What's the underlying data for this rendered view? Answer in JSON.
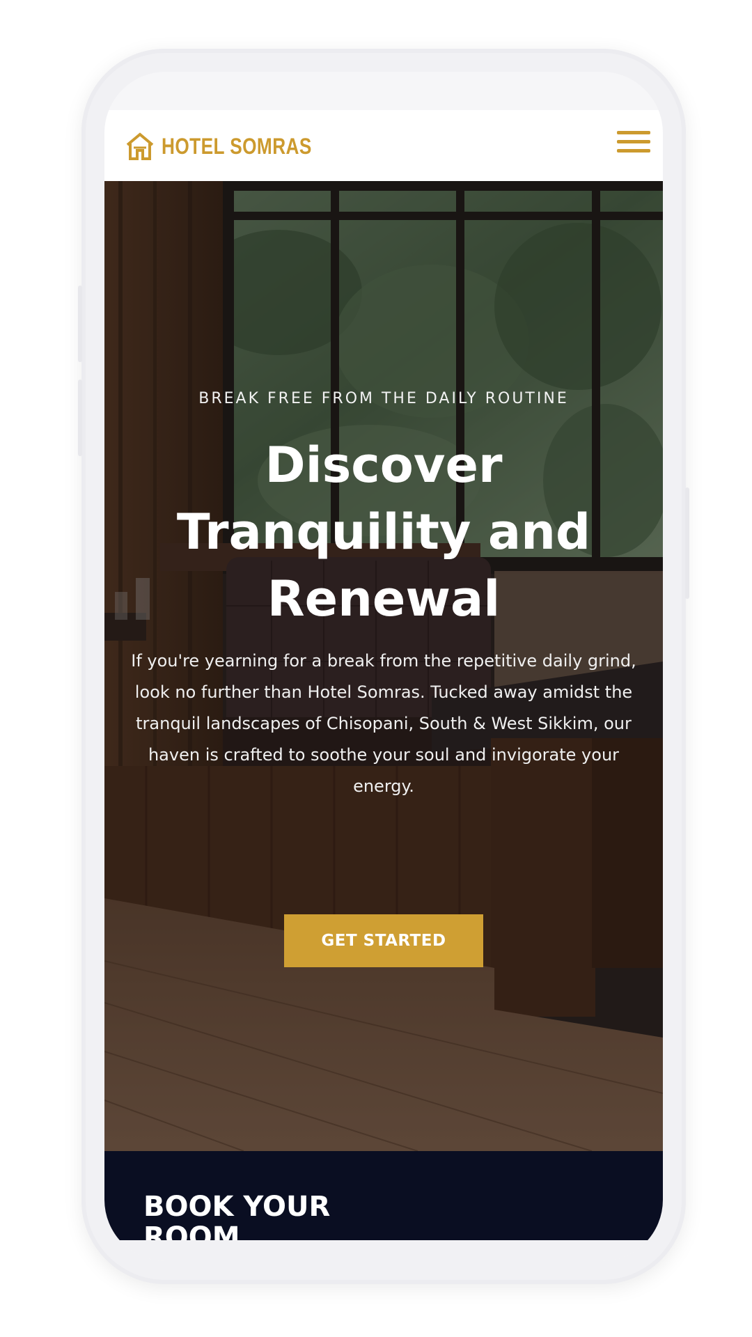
{
  "brand": {
    "name": "HOTEL SOMRAS",
    "logo_icon": "house-outline-icon",
    "accent_color": "#cc9a2e"
  },
  "nav": {
    "menu_icon": "hamburger-menu-icon"
  },
  "hero": {
    "eyebrow": "BREAK FREE FROM THE DAILY ROUTINE",
    "title": "Discover Tranquility and Renewal",
    "description": "If you're yearning for a break from the repetitive daily grind, look no further than Hotel Somras. Tucked away amidst the tranquil landscapes of Chisopani, South & West Sikkim, our haven is crafted to soothe your soul and invigorate your energy.",
    "cta_label": "GET STARTED",
    "cta_color": "#cf9f33"
  },
  "booking": {
    "title": "BOOK YOUR ROOM",
    "background_color": "#0a0e22"
  }
}
